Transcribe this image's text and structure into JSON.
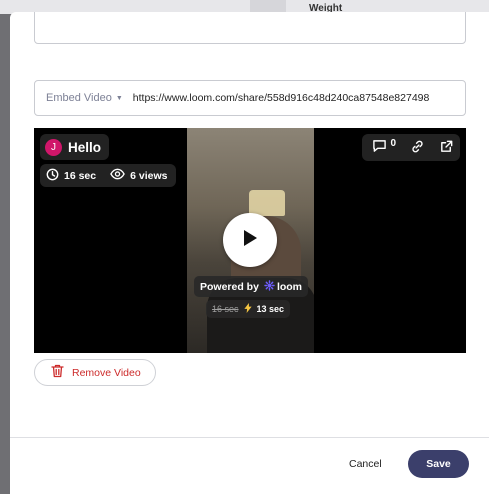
{
  "backdrop": {
    "field_label": "Weight"
  },
  "embed": {
    "type_label": "Embed Video",
    "url": "https://www.loom.com/share/558d916c48d240ca87548e827498"
  },
  "video": {
    "avatar_initial": "J",
    "title": "Hello",
    "duration": "16 sec",
    "views": "6 views",
    "comment_count": "0",
    "powered_by": "Powered by",
    "brand": "loom",
    "original_duration": "16 sec",
    "fast_duration": "13 sec"
  },
  "actions": {
    "remove_label": "Remove Video",
    "cancel_label": "Cancel",
    "save_label": "Save"
  },
  "colors": {
    "accent": "#3b3f6b",
    "danger": "#cc2a2a",
    "avatar": "#d0166a"
  },
  "icons": [
    "chevron-down-icon",
    "clock-icon",
    "eye-icon",
    "comment-icon",
    "link-icon",
    "external-link-icon",
    "play-icon",
    "loom-logo-icon",
    "lightning-icon",
    "trash-icon"
  ]
}
